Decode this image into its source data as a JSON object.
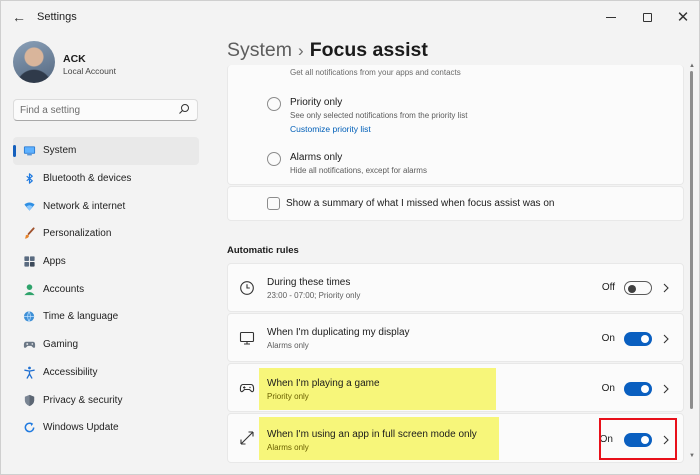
{
  "window": {
    "app_title": "Settings"
  },
  "account": {
    "name": "ACK",
    "type": "Local Account"
  },
  "search": {
    "placeholder": "Find a setting"
  },
  "sidebar": {
    "items": [
      {
        "label": "System",
        "icon": "system-display-icon",
        "active": true
      },
      {
        "label": "Bluetooth & devices",
        "icon": "bluetooth-icon"
      },
      {
        "label": "Network & internet",
        "icon": "wifi-icon"
      },
      {
        "label": "Personalization",
        "icon": "brush-icon"
      },
      {
        "label": "Apps",
        "icon": "apps-icon"
      },
      {
        "label": "Accounts",
        "icon": "person-icon"
      },
      {
        "label": "Time & language",
        "icon": "globe-clock-icon"
      },
      {
        "label": "Gaming",
        "icon": "gamepad-icon"
      },
      {
        "label": "Accessibility",
        "icon": "accessibility-icon"
      },
      {
        "label": "Privacy & security",
        "icon": "shield-icon"
      },
      {
        "label": "Windows Update",
        "icon": "update-icon"
      }
    ]
  },
  "breadcrumb": {
    "parent": "System",
    "separator": "›",
    "current": "Focus assist"
  },
  "focus_options": {
    "clipped_text": "Get all notifications from your apps and contacts",
    "priority": {
      "title": "Priority only",
      "description": "See only selected notifications from the priority list",
      "link": "Customize priority list"
    },
    "alarms": {
      "title": "Alarms only",
      "description": "Hide all notifications, except for alarms"
    },
    "summary_checkbox": "Show a summary of what I missed when focus assist was on"
  },
  "automatic_rules": {
    "heading": "Automatic rules",
    "rules": [
      {
        "title": "During these times",
        "subtitle": "23:00 - 07:00; Priority only",
        "state": "Off",
        "on": false,
        "icon": "clock-icon"
      },
      {
        "title": "When I'm duplicating my display",
        "subtitle": "Alarms only",
        "state": "On",
        "on": true,
        "icon": "monitor-icon"
      },
      {
        "title": "When I'm playing a game",
        "subtitle": "Priority only",
        "state": "On",
        "on": true,
        "icon": "gamepad-icon"
      },
      {
        "title": "When I'm using an app in full screen mode only",
        "subtitle": "Alarms only",
        "state": "On",
        "on": true,
        "icon": "fullscreen-icon"
      }
    ]
  },
  "colors": {
    "accent": "#0a5fc0",
    "highlight": "#f6f56b",
    "annotation_red": "#e8101a"
  }
}
